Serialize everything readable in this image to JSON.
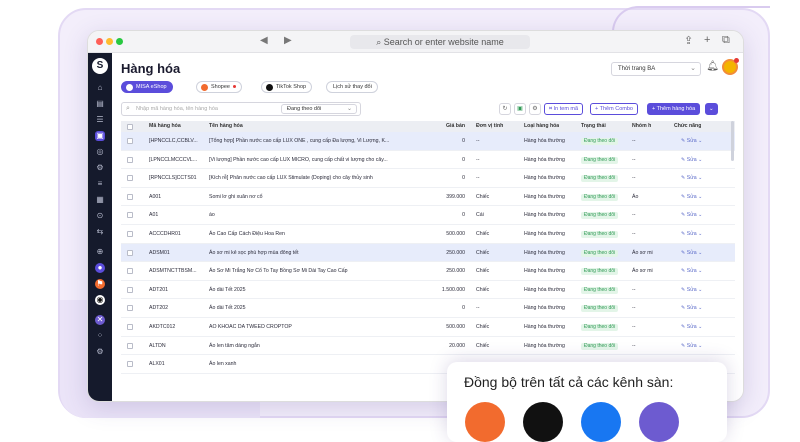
{
  "browser": {
    "url_placeholder": "Search or enter website name",
    "nav_icons": [
      "◀",
      "▶"
    ],
    "right_icons": [
      "⇪",
      "+",
      "⧉"
    ]
  },
  "rail_icons": [
    "⌂",
    "▤",
    "☰",
    "▣",
    "◎",
    "⚙",
    "≡",
    "▦",
    "⊙",
    "⇆",
    "⊕",
    "●",
    "⚑",
    "◉",
    "✕",
    "⁘",
    "⚙"
  ],
  "header": {
    "title": "Hàng hóa",
    "store_select": "Thời trang BA"
  },
  "channels": [
    {
      "label": "MISA eShop",
      "active": true,
      "color": "#ffffff"
    },
    {
      "label": "Shopee",
      "active": false,
      "color": "#f26b2e",
      "dot": true
    },
    {
      "label": "TikTok Shop",
      "active": false,
      "color": "#111111"
    },
    {
      "label": "Lịch sử thay đổi",
      "active": false,
      "color": ""
    }
  ],
  "toolbar": {
    "search_placeholder": "Nhập mã hàng hóa, tên hàng hóa",
    "filter_label": "Đang theo dõi",
    "print_label": "In tem mã",
    "combo_label": "+ Thêm Combo",
    "add_label": "+ Thêm hàng hóa"
  },
  "table": {
    "headers": [
      "Mã hàng hóa",
      "Tên hàng hóa",
      "Giá bán",
      "Đơn vị tính",
      "Loại hàng hóa",
      "Trạng thái",
      "Nhóm h",
      "Chức năng"
    ],
    "rows": [
      {
        "code": "[HPNCCLC,CCBLV...",
        "name": "[Tổng hợp] Phần nước cao cấp LUX ONE , cung cấp Đa lượng, Vi Lượng, K...",
        "price": "0",
        "unit": "--",
        "type": "Hàng hóa thường",
        "status": "Đang theo dõi",
        "group": "--",
        "action": "Sửa",
        "selected": true
      },
      {
        "code": "[LPNCCLMCCCVL...",
        "name": "[Vi lượng] Phần nước cao cấp LUX MICRO, cung cấp chất vi lượng cho cây...",
        "price": "0",
        "unit": "--",
        "type": "Hàng hóa thường",
        "status": "Đang theo dõi",
        "group": "--",
        "action": "Sửa",
        "selected": false
      },
      {
        "code": "[RPNCCLS]CCTS01",
        "name": "[Kích rễ] Phân nước cao cấp LUX Stimulate (Doping) cho cây thủy sinh",
        "price": "0",
        "unit": "--",
        "type": "Hàng hóa thường",
        "status": "Đang theo dõi",
        "group": "--",
        "action": "Sửa",
        "selected": false
      },
      {
        "code": "A001",
        "name": "Somi lơ ghi xuân nơ cổ",
        "price": "399.000",
        "unit": "Chiếc",
        "type": "Hàng hóa thường",
        "status": "Đang theo dõi",
        "group": "Áo",
        "action": "Sửa",
        "selected": false
      },
      {
        "code": "A01",
        "name": "áo",
        "price": "0",
        "unit": "Cái",
        "type": "Hàng hóa thường",
        "status": "Đang theo dõi",
        "group": "--",
        "action": "Sửa",
        "selected": false
      },
      {
        "code": "ACCCDHR01",
        "name": "Áo Cao Cấp Cách Điệu Hoa Ren",
        "price": "500.000",
        "unit": "Chiếc",
        "type": "Hàng hóa thường",
        "status": "Đang theo dõi",
        "group": "--",
        "action": "Sửa",
        "selected": false
      },
      {
        "code": "ADSM01",
        "name": "Áo sơ mi kẻ sọc phù hợp mùa đông tết",
        "price": "250.000",
        "unit": "Chiếc",
        "type": "Hàng hóa thường",
        "status": "Đang theo dõi",
        "group": "Áo sơ mi",
        "action": "Sửa",
        "selected": true
      },
      {
        "code": "ADSMTNCTTBSM...",
        "name": "Áo Sơ Mi Trắng Nơ Cổ To Tay Bồng Sơ Mi Dài Tay Cao Cấp",
        "price": "250.000",
        "unit": "Chiếc",
        "type": "Hàng hóa thường",
        "status": "Đang theo dõi",
        "group": "Áo sơ mi",
        "action": "Sửa",
        "selected": false
      },
      {
        "code": "ADT201",
        "name": "Áo dài Tết 2025",
        "price": "1.500.000",
        "unit": "Chiếc",
        "type": "Hàng hóa thường",
        "status": "Đang theo dõi",
        "group": "--",
        "action": "Sửa",
        "selected": false
      },
      {
        "code": "ADT202",
        "name": "Áo dài Tết 2025",
        "price": "0",
        "unit": "--",
        "type": "Hàng hóa thường",
        "status": "Đang theo dõi",
        "group": "--",
        "action": "Sửa",
        "selected": false
      },
      {
        "code": "AKDTC012",
        "name": "AO KHOAC DA TWEED CROPTOP",
        "price": "500.000",
        "unit": "Chiếc",
        "type": "Hàng hóa thường",
        "status": "Đang theo dõi",
        "group": "--",
        "action": "Sửa",
        "selected": false
      },
      {
        "code": "ALTDN",
        "name": "Áo len tâm dáng ngắn",
        "price": "20.000",
        "unit": "Chiếc",
        "type": "Hàng hóa thường",
        "status": "Đang theo dõi",
        "group": "--",
        "action": "Sửa",
        "selected": false
      },
      {
        "code": "ALX01",
        "name": "Áo len xanh",
        "price": "",
        "unit": "",
        "type": "",
        "status": "",
        "group": "",
        "action": "",
        "selected": false
      }
    ]
  },
  "popup": {
    "title": "Đồng bộ trên tất cả các kênh sàn:",
    "channel_colors": [
      "#f26b2e",
      "#111111",
      "#1877f2",
      "#6d5bd0"
    ]
  },
  "colors": {
    "accent": "#5b4ddb",
    "rail": "#151a2c",
    "status_green": "#2f9a55"
  }
}
